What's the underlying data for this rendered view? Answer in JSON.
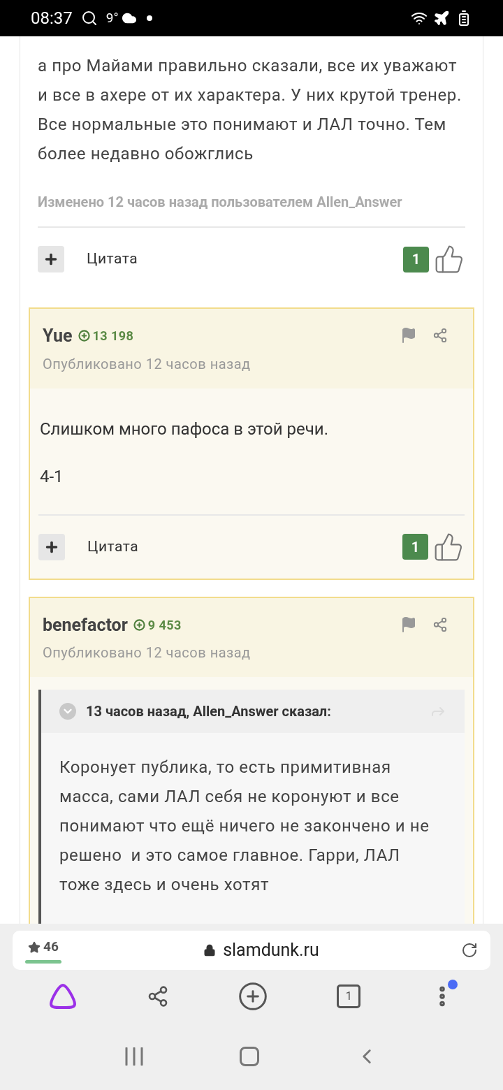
{
  "status_bar": {
    "time": "08:37",
    "temperature": "9°"
  },
  "previous_post": {
    "body": "а про Майами правильно сказали, все их уважают и все в ахере от их характера. У них крутой тренер. Все нормальные это понимают и ЛАЛ точно. Тем более недавно обожглись",
    "edited_note": "Изменено 12 часов назад пользователем Allen_Answer",
    "quote_label": "Цитата",
    "likes": "1"
  },
  "posts": [
    {
      "author": "Yue",
      "reputation": "13 198",
      "published": "Опубликовано 12 часов назад",
      "paragraphs": [
        "Слишком много пафоса в этой речи.",
        "4-1"
      ],
      "quote_label": "Цитата",
      "likes": "1"
    },
    {
      "author": "benefactor",
      "reputation": "9 453",
      "published": "Опубликовано 12 часов назад",
      "quote": {
        "header": "13 часов назад, Allen_Answer сказал:",
        "text": "Коронует публика, то есть примитивная масса, сами ЛАЛ себя не коронуют и все понимают что ещё ничего не закончено и не решено  и это самое главное. Гарри, ЛАЛ тоже здесь и очень хотят"
      }
    }
  ],
  "browser": {
    "bookmarks": "46",
    "url": "slamdunk.ru",
    "tabs_count": "1",
    "menu_notification": true
  }
}
